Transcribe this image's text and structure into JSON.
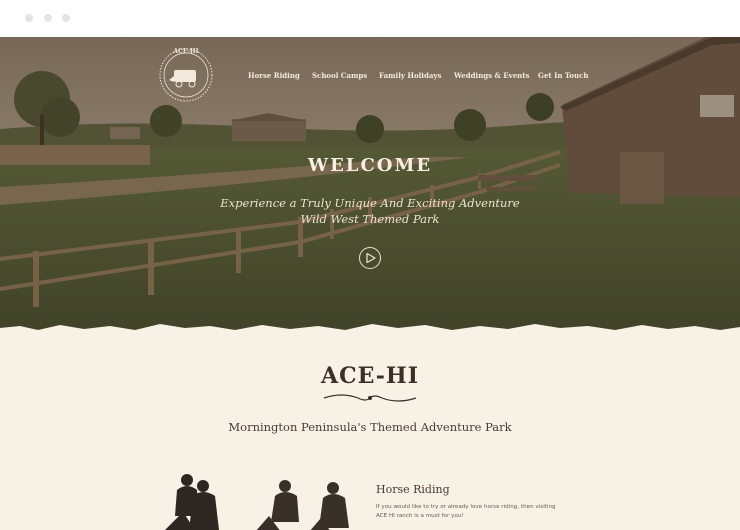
{
  "brand": {
    "logo_name": "ACE-HI",
    "name": "ACE-HI",
    "tagline": "Mornington Peninsula's Themed Adventure Park"
  },
  "nav": {
    "items": [
      {
        "label": "Horse Riding"
      },
      {
        "label": "School Camps"
      },
      {
        "label": "Family Holidays"
      },
      {
        "label": "Weddings & Events"
      },
      {
        "label": "Get In Touch"
      }
    ]
  },
  "hero": {
    "title": "WELCOME",
    "subtitle_line1": "Experience a Truly Unique And Exciting Adventure",
    "subtitle_line2": "Wild West Themed Park",
    "play_icon": "play-icon"
  },
  "feature": {
    "title": "Horse Riding",
    "text_line1": "If you would like to try or already love horse riding, then visiting",
    "text_line2": "ACE HI ranch is a must for you!"
  },
  "colors": {
    "accent_dark": "#3d2f25",
    "cream": "#f8f1e6",
    "hero_tint": "#5a5440"
  }
}
